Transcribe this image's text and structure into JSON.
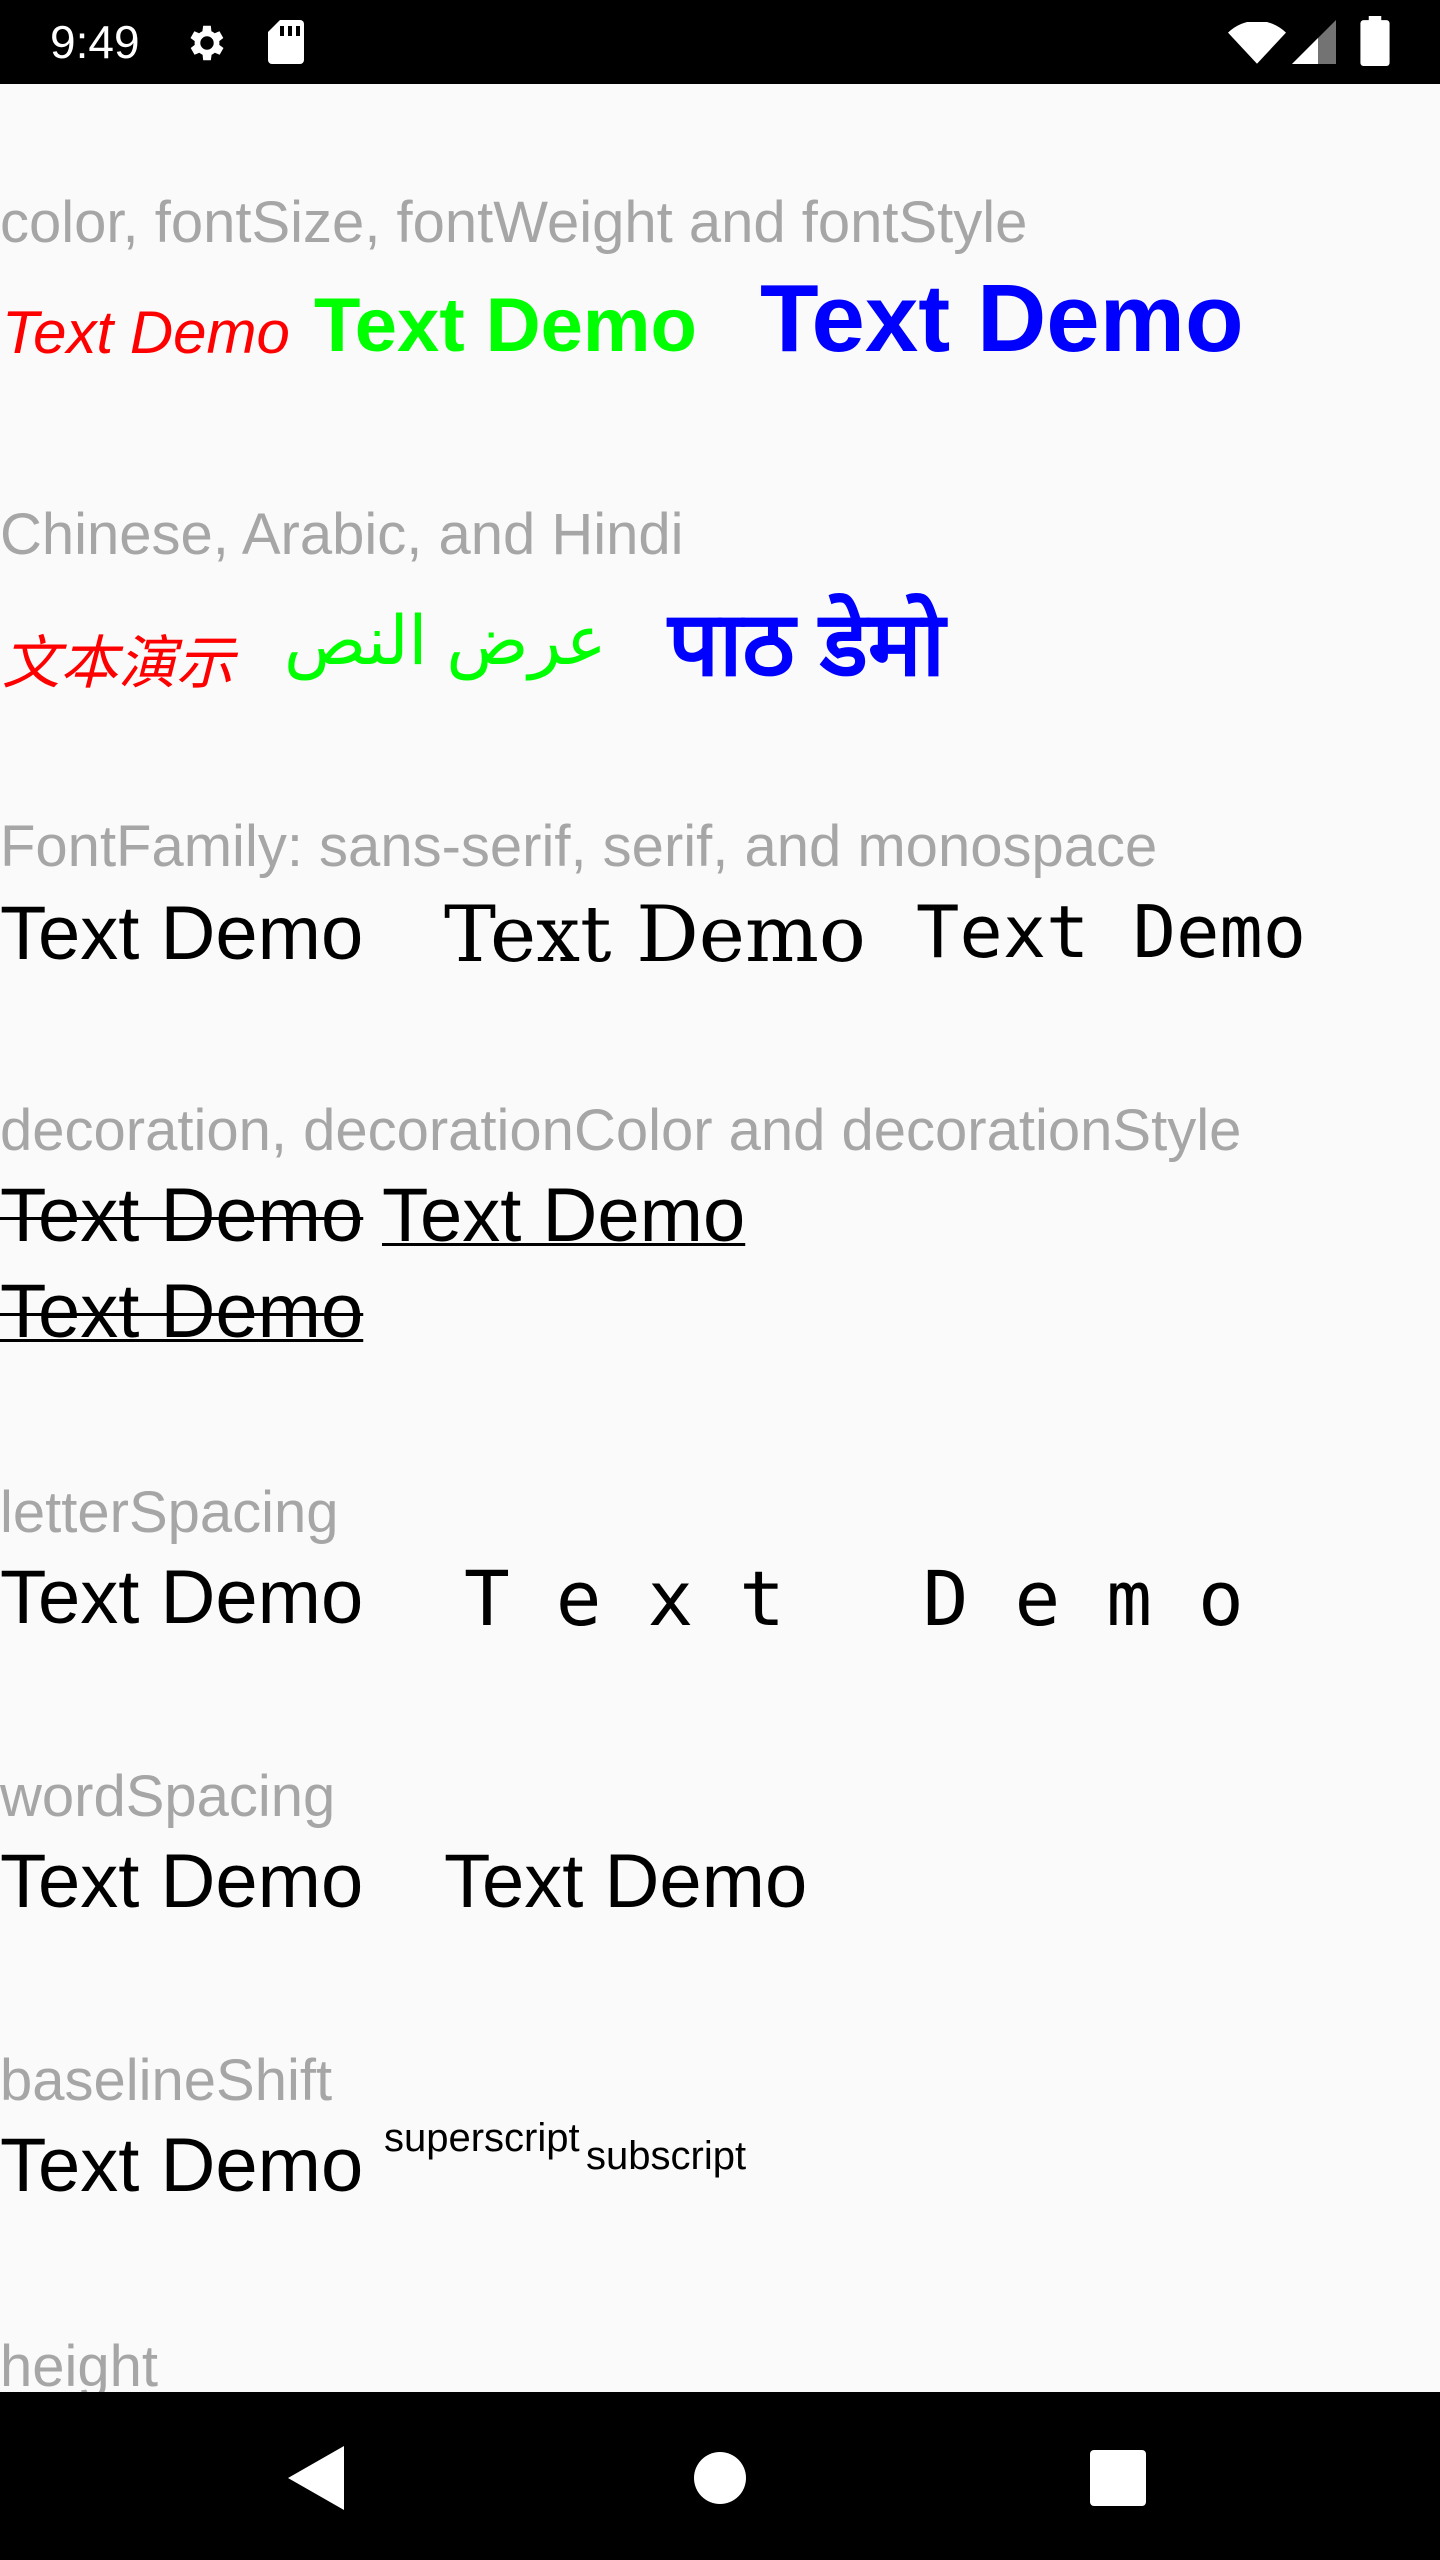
{
  "status_bar": {
    "time": "9:49",
    "icons": [
      "gear-icon",
      "sd-card-icon",
      "wifi-icon",
      "signal-icon",
      "battery-icon"
    ]
  },
  "sections": {
    "style": {
      "heading": "color, fontSize, fontWeight and fontStyle",
      "samples": [
        "Text Demo",
        "Text Demo",
        "Text Demo"
      ],
      "colors": [
        "#ff0000",
        "#00ff00",
        "#0000ff"
      ]
    },
    "i18n": {
      "heading": "Chinese, Arabic, and Hindi",
      "chinese": "文本演示",
      "arabic": "عرض النص",
      "hindi": "पाठ डेमो"
    },
    "font_family": {
      "heading": "FontFamily: sans-serif, serif, and monospace",
      "samples": [
        "Text Demo",
        "Text Demo",
        "Text Demo"
      ]
    },
    "decoration": {
      "heading": "decoration, decorationColor and decorationStyle",
      "samples": [
        "Text Demo",
        "Text Demo",
        "Text Demo"
      ]
    },
    "letter_spacing": {
      "heading": "letterSpacing",
      "samples": [
        "Text Demo",
        "Text Demo"
      ]
    },
    "word_spacing": {
      "heading": "wordSpacing",
      "samples": [
        "Text Demo",
        "Text Demo"
      ]
    },
    "baseline_shift": {
      "heading": "baselineShift",
      "main": "Text Demo",
      "superscript": "superscript",
      "subscript": "subscript"
    },
    "height": {
      "heading": "height"
    }
  }
}
